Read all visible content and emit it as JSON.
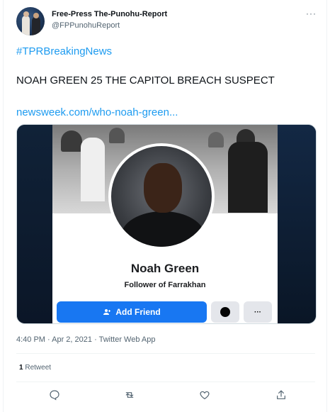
{
  "author": {
    "name": "Free-Press The-Punohu-Report",
    "handle": "@FPPunohuReport"
  },
  "tweet": {
    "hashtag": "#TPRBreakingNews",
    "headline": "NOAH GREEN 25 THE CAPITOL BREACH SUSPECT",
    "link": "newsweek.com/who-noah-green...",
    "more_label": "···"
  },
  "media": {
    "profile_name": "Noah Green",
    "profile_subtitle": "Follower of Farrakhan",
    "add_friend_label": "Add Friend",
    "more_label": "···"
  },
  "meta": {
    "timestamp": "4:40 PM · Apr 2, 2021 · Twitter Web App"
  },
  "stats": {
    "retweet_count": "1",
    "retweet_label": "Retweet"
  },
  "colors": {
    "link_blue": "#1d9bf0",
    "facebook_blue": "#1877f2"
  }
}
